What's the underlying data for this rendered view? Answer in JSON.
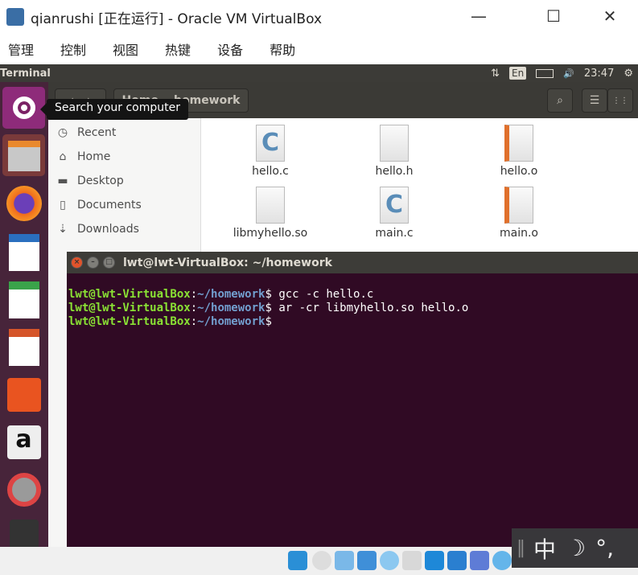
{
  "window": {
    "title": "qianrushi [正在运行] - Oracle VM VirtualBox",
    "minimize": "—",
    "maximize": "☐",
    "close": "✕"
  },
  "menu": [
    "管理",
    "控制",
    "视图",
    "热键",
    "设备",
    "帮助"
  ],
  "panel": {
    "app": "Terminal",
    "lang": "En",
    "time": "23:47",
    "network_icon": "⇅",
    "sound_icon": "🔊",
    "power_icon": "⚙"
  },
  "tooltip": "Search your computer",
  "nautilus": {
    "breadcrumb_home": "Home",
    "breadcrumb_current": "homework",
    "back": "‹",
    "forward": "›",
    "search_icon": "⌕",
    "list_icon": "☰",
    "grid_icon": "⋮⋮"
  },
  "sidebar": [
    {
      "label": "Recent",
      "icon": "◷"
    },
    {
      "label": "Home",
      "icon": "⌂"
    },
    {
      "label": "Desktop",
      "icon": "▬"
    },
    {
      "label": "Documents",
      "icon": "▯"
    },
    {
      "label": "Downloads",
      "icon": "⇣"
    }
  ],
  "files": [
    {
      "name": "hello.c",
      "type": "c"
    },
    {
      "name": "hello.h",
      "type": "h"
    },
    {
      "name": "hello.o",
      "type": "o"
    },
    {
      "name": "libmyhello.so",
      "type": "txt"
    },
    {
      "name": "main.c",
      "type": "c"
    },
    {
      "name": "main.o",
      "type": "o"
    }
  ],
  "terminal": {
    "title": "lwt@lwt-VirtualBox: ~/homework",
    "user": "lwt@lwt-VirtualBox",
    "path": "~/homework",
    "lines": [
      {
        "cmd": " gcc -c hello.c"
      },
      {
        "cmd": " ar -cr libmyhello.so hello.o"
      },
      {
        "cmd": ""
      }
    ]
  },
  "ime": {
    "sep": "‖",
    "mode": "中",
    "moon": "☽",
    "punct": "°,"
  }
}
